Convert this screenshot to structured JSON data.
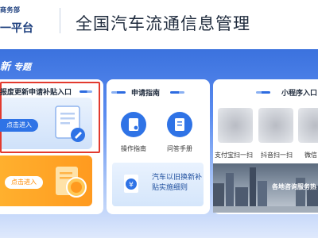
{
  "header": {
    "ministry": "商务部",
    "platform": "一平台",
    "title": "全国汽车流通信息管理"
  },
  "banner": {
    "title_part1": "新",
    "title_part2": "专题"
  },
  "left": {
    "card_title": "报废更新申请补贴入口",
    "btn_enter_blue": "点击进入",
    "btn_enter_orange": "点击进入"
  },
  "guide": {
    "title": "申请指南",
    "items": [
      {
        "label": "操作指南",
        "icon": "guide-icon"
      },
      {
        "label": "问答手册",
        "icon": "manual-icon"
      }
    ],
    "rules_text": "汽车以旧换新补贴实施细则"
  },
  "miniprogram": {
    "title": "小程序入口",
    "items": [
      {
        "label": "支付宝扫一扫"
      },
      {
        "label": "抖音扫一扫"
      },
      {
        "label": "微信"
      }
    ],
    "service_caption": "各地咨询服务热"
  },
  "colors": {
    "accent_blue": "#2f73e6",
    "orange": "#ff9a1f",
    "highlight_red": "#e23a2e"
  }
}
